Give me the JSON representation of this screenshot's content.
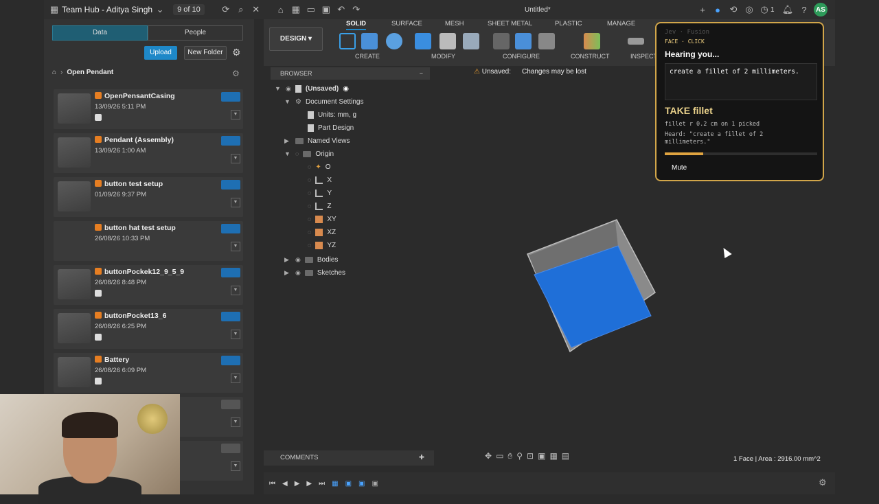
{
  "topbar": {
    "team": "Team Hub - Aditya Singh",
    "count": "9 of 10",
    "doc_title": "Untitled*",
    "notif_count": "1",
    "avatar": "AS"
  },
  "left": {
    "tabs": [
      "Data",
      "People"
    ],
    "upload": "Upload",
    "new_folder": "New Folder",
    "breadcrumb": "Open Pendant",
    "files": [
      {
        "name": "OpenPensantCasing",
        "date": "13/09/26 5:11 PM"
      },
      {
        "name": "Pendant (Assembly)",
        "date": "13/09/26 1:00 AM"
      },
      {
        "name": "button test setup",
        "date": "01/09/26 9:37 PM"
      },
      {
        "name": "button hat test setup",
        "date": "26/08/26 10:33 PM"
      },
      {
        "name": "buttonPockek12_9_5_9",
        "date": "26/08/26 8:48 PM"
      },
      {
        "name": "buttonPocket13_6",
        "date": "26/08/26 6:25 PM"
      },
      {
        "name": "Battery",
        "date": "26/08/26 6:09 PM"
      }
    ]
  },
  "toolbar": {
    "workspace": "DESIGN",
    "tabs": [
      "SOLID",
      "SURFACE",
      "MESH",
      "SHEET METAL",
      "PLASTIC",
      "MANAGE"
    ],
    "groups": [
      "CREATE",
      "MODIFY",
      "CONFIGURE",
      "CONSTRUCT",
      "INSPECT"
    ]
  },
  "browser": {
    "header": "BROWSER",
    "root": "(Unsaved)",
    "rows": [
      "Document Settings",
      "Units: mm, g",
      "Part Design",
      "Named Views",
      "Origin",
      "O",
      "X",
      "Y",
      "Z",
      "XY",
      "XZ",
      "YZ",
      "Bodies",
      "Sketches"
    ]
  },
  "unsaved": {
    "label": "Unsaved:",
    "message": "Changes may be lost"
  },
  "card": {
    "title": "Jev · Fusion",
    "subtitle": "FACE · CLICK",
    "hearing": "Hearing you...",
    "input": "create a fillet of 2 millimeters.",
    "take": "TAKE fillet",
    "line1": "fillet r 0.2 cm on 1 picked",
    "line2": "Heard: \"create a fillet of 2 millimeters.\"",
    "progress": 0.25,
    "mute": "Mute"
  },
  "bottom": {
    "comments": "COMMENTS",
    "status": "1 Face | Area : 2916.00 mm^2"
  },
  "colors": {
    "accent": "#1e88c8",
    "card_border": "#d2a64a",
    "face": "#1f6fd8"
  }
}
